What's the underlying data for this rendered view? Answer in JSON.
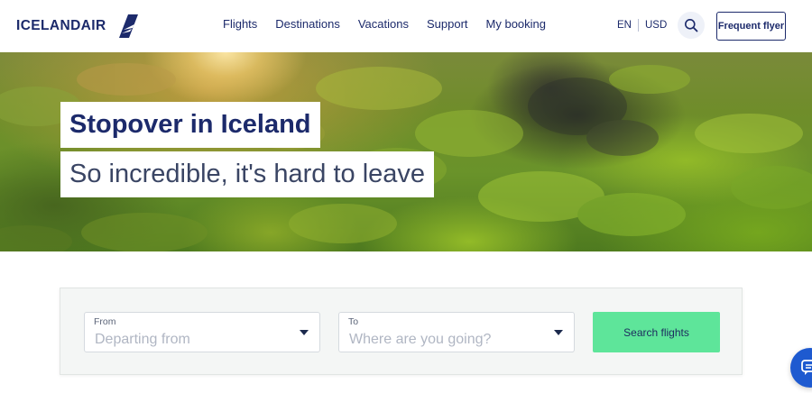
{
  "brand": {
    "name": "ICELANDAIR",
    "color": "#1c2a6b"
  },
  "nav": {
    "items": [
      "Flights",
      "Destinations",
      "Vacations",
      "Support",
      "My booking"
    ]
  },
  "header": {
    "language": "EN",
    "currency": "USD",
    "search_icon": "search-icon",
    "frequent_flyer_label": "Frequent flyer"
  },
  "hero": {
    "headline": "Stopover in Iceland",
    "subheadline": "So incredible, it's hard to leave"
  },
  "booking": {
    "from": {
      "label": "From",
      "placeholder": "Departing from"
    },
    "to": {
      "label": "To",
      "placeholder": "Where are you going?"
    },
    "search_button_label": "Search flights",
    "accent_color": "#5ee59a"
  },
  "chat": {
    "icon": "chat-icon",
    "color": "#1e5ad0"
  }
}
